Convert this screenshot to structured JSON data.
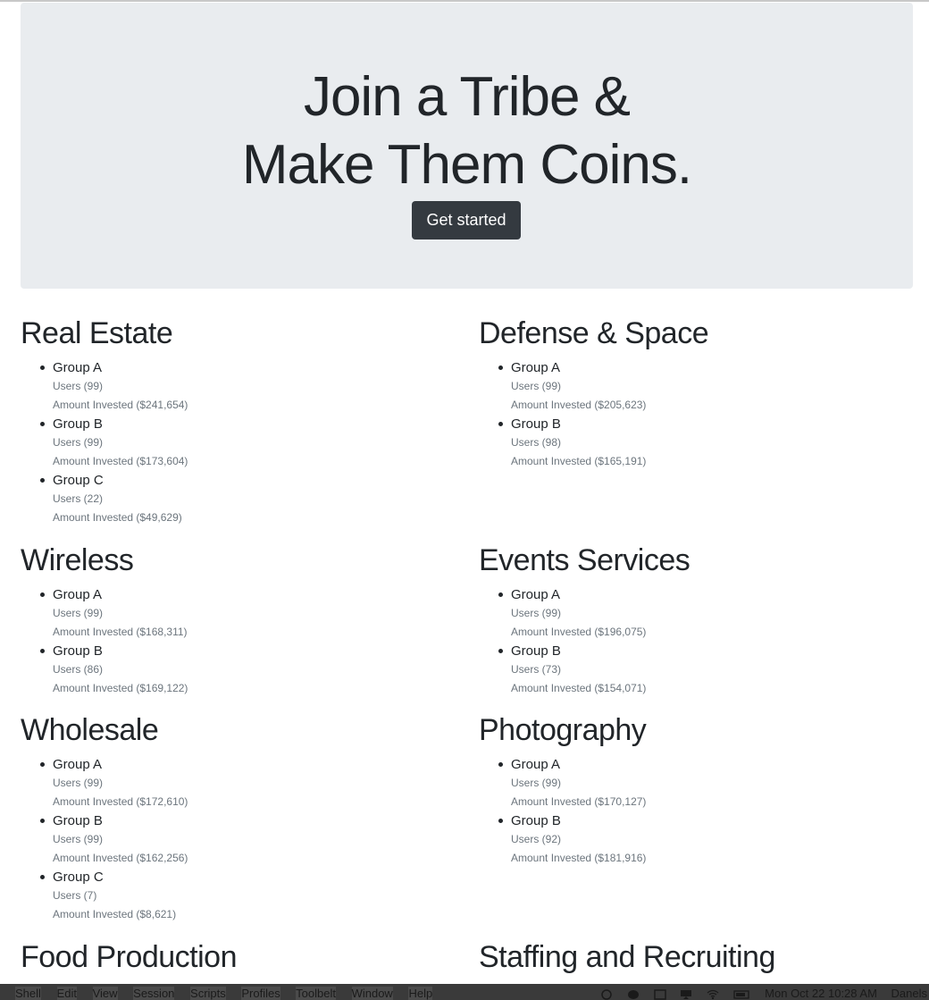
{
  "hero": {
    "line1": "Join a Tribe &",
    "line2": "Make Them Coins.",
    "cta": "Get started"
  },
  "categories": [
    {
      "title": "Real Estate",
      "groups": [
        {
          "name": "Group A",
          "users": "Users (99)",
          "invested": "Amount Invested ($241,654)"
        },
        {
          "name": "Group B",
          "users": "Users (99)",
          "invested": "Amount Invested ($173,604)"
        },
        {
          "name": "Group C",
          "users": "Users (22)",
          "invested": "Amount Invested ($49,629)"
        }
      ]
    },
    {
      "title": "Defense & Space",
      "groups": [
        {
          "name": "Group A",
          "users": "Users (99)",
          "invested": "Amount Invested ($205,623)"
        },
        {
          "name": "Group B",
          "users": "Users (98)",
          "invested": "Amount Invested ($165,191)"
        }
      ]
    },
    {
      "title": "Wireless",
      "groups": [
        {
          "name": "Group A",
          "users": "Users (99)",
          "invested": "Amount Invested ($168,311)"
        },
        {
          "name": "Group B",
          "users": "Users (86)",
          "invested": "Amount Invested ($169,122)"
        }
      ]
    },
    {
      "title": "Events Services",
      "groups": [
        {
          "name": "Group A",
          "users": "Users (99)",
          "invested": "Amount Invested ($196,075)"
        },
        {
          "name": "Group B",
          "users": "Users (73)",
          "invested": "Amount Invested ($154,071)"
        }
      ]
    },
    {
      "title": "Wholesale",
      "groups": [
        {
          "name": "Group A",
          "users": "Users (99)",
          "invested": "Amount Invested ($172,610)"
        },
        {
          "name": "Group B",
          "users": "Users (99)",
          "invested": "Amount Invested ($162,256)"
        },
        {
          "name": "Group C",
          "users": "Users (7)",
          "invested": "Amount Invested ($8,621)"
        }
      ]
    },
    {
      "title": "Photography",
      "groups": [
        {
          "name": "Group A",
          "users": "Users (99)",
          "invested": "Amount Invested ($170,127)"
        },
        {
          "name": "Group B",
          "users": "Users (92)",
          "invested": "Amount Invested ($181,916)"
        }
      ]
    },
    {
      "title": "Food Production",
      "groups": []
    },
    {
      "title": "Staffing and Recruiting",
      "groups": []
    }
  ],
  "menubar": {
    "items": [
      "Shell",
      "Edit",
      "View",
      "Session",
      "Scripts",
      "Profiles",
      "Toolbelt",
      "Window",
      "Help"
    ],
    "clock": "Mon Oct 22  10:28 AM",
    "user": "Danels"
  }
}
